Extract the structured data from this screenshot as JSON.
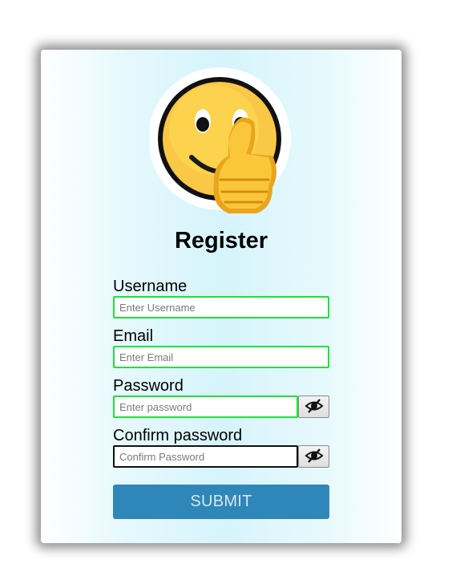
{
  "form": {
    "title": "Register",
    "avatar_icon": "smiley-thumbs-up-icon",
    "fields": [
      {
        "label": "Username",
        "placeholder": "Enter Username",
        "value": ""
      },
      {
        "label": "Email",
        "placeholder": "Enter Email",
        "value": ""
      },
      {
        "label": "Password",
        "placeholder": "Enter password",
        "value": "",
        "toggle_icon": "eye-slash-icon"
      },
      {
        "label": "Confirm password",
        "placeholder": "Confirm Password",
        "value": "",
        "toggle_icon": "eye-slash-icon",
        "focused": true
      }
    ],
    "submit_label": "SUBMIT"
  },
  "colors": {
    "valid_border": "#22e03c",
    "focused_border": "#111111",
    "submit_bg": "#2e87b8",
    "submit_text": "#d8e6ee"
  }
}
